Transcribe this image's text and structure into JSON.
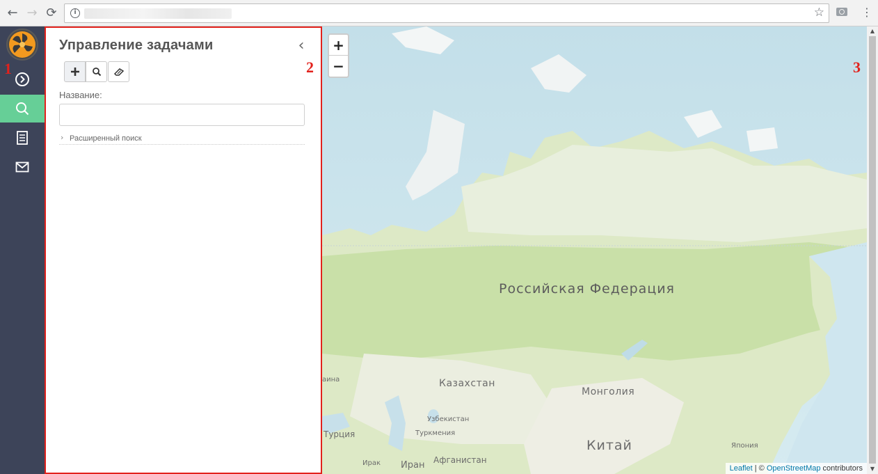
{
  "browser": {
    "back_icon": "arrow-left-icon",
    "forward_icon": "arrow-right-icon",
    "reload_icon": "reload-icon",
    "bookmark_icon": "star-icon",
    "screenshot_icon": "camera-icon",
    "menu_icon": "kebab-menu-icon"
  },
  "sidebar": {
    "items": [
      {
        "name": "expand",
        "icon": "chevron-circle-right-icon"
      },
      {
        "name": "search",
        "icon": "search-icon",
        "active": true
      },
      {
        "name": "documents",
        "icon": "document-list-icon"
      },
      {
        "name": "messages",
        "icon": "envelope-icon"
      }
    ],
    "active_color": "#66cf97",
    "bg_color": "#3d4459"
  },
  "panel": {
    "title": "Управление задачами",
    "collapse_icon": "chevron-left-icon",
    "toolbar": [
      {
        "name": "add",
        "icon": "plus-icon"
      },
      {
        "name": "search",
        "icon": "search-icon"
      },
      {
        "name": "clear",
        "icon": "eraser-icon"
      }
    ],
    "name_label": "Название:",
    "name_value": "",
    "advanced_search_label": "Расширенный поиск"
  },
  "map": {
    "zoom_in": "+",
    "zoom_out": "−",
    "labels": {
      "russia": "Российская Федерация",
      "kazakhstan": "Казахстан",
      "mongolia": "Монголия",
      "china": "Китай",
      "uzbekistan": "Узбекистан",
      "turkmenistan": "Туркмения",
      "turkey": "Турция",
      "iran": "Иран",
      "iraq": "Ирак",
      "afghanistan": "Афганистан",
      "japan": "Япония",
      "ukraine_partial": "аина"
    },
    "attribution": {
      "leaflet": "Leaflet",
      "separator": " | © ",
      "osm": "OpenStreetMap",
      "suffix": " contributors"
    }
  },
  "annotations": {
    "one": "1",
    "two": "2",
    "three": "3"
  },
  "colors": {
    "highlight_border": "#e2211c",
    "water": "#cfe7ef",
    "land": "#dde9c6"
  }
}
